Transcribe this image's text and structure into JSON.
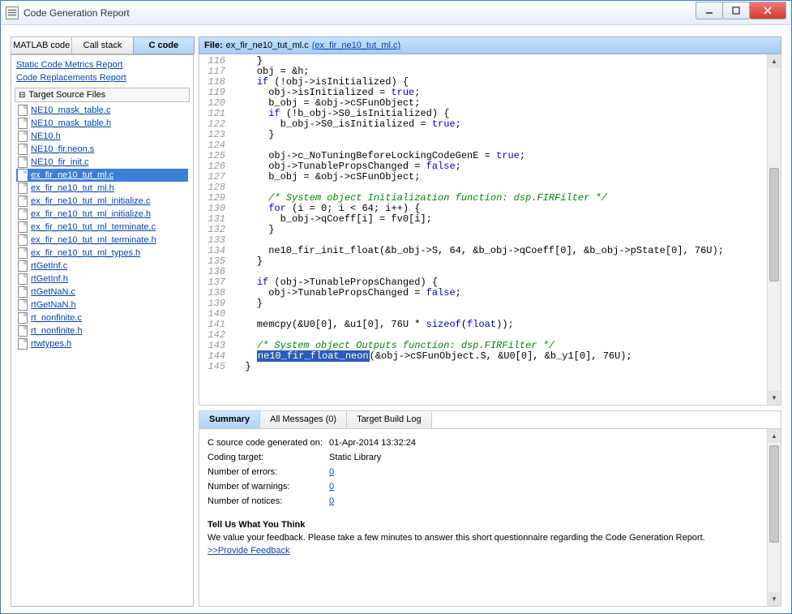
{
  "window": {
    "title": "Code Generation Report"
  },
  "sidebar": {
    "tabs": [
      {
        "label": "MATLAB code",
        "active": false
      },
      {
        "label": "Call stack",
        "active": false
      },
      {
        "label": "C code",
        "active": true
      }
    ],
    "top_links": [
      "Static Code Metrics Report",
      "Code Replacements Report"
    ],
    "section": "Target Source Files",
    "files": [
      {
        "name": "NE10_mask_table.c",
        "selected": false
      },
      {
        "name": "NE10_mask_table.h",
        "selected": false
      },
      {
        "name": "NE10.h",
        "selected": false
      },
      {
        "name": "NE10_fir.neon.s",
        "selected": false
      },
      {
        "name": "NE10_fir_init.c",
        "selected": false
      },
      {
        "name": "ex_fir_ne10_tut_ml.c",
        "selected": true
      },
      {
        "name": "ex_fir_ne10_tut_ml.h",
        "selected": false
      },
      {
        "name": "ex_fir_ne10_tut_ml_initialize.c",
        "selected": false
      },
      {
        "name": "ex_fir_ne10_tut_ml_initialize.h",
        "selected": false
      },
      {
        "name": "ex_fir_ne10_tut_ml_terminate.c",
        "selected": false
      },
      {
        "name": "ex_fir_ne10_tut_ml_terminate.h",
        "selected": false
      },
      {
        "name": "ex_fir_ne10_tut_ml_types.h",
        "selected": false
      },
      {
        "name": "rtGetInf.c",
        "selected": false
      },
      {
        "name": "rtGetInf.h",
        "selected": false
      },
      {
        "name": "rtGetNaN.c",
        "selected": false
      },
      {
        "name": "rtGetNaN.h",
        "selected": false
      },
      {
        "name": "rt_nonfinite.c",
        "selected": false
      },
      {
        "name": "rt_nonfinite.h",
        "selected": false
      },
      {
        "name": "rtwtypes.h",
        "selected": false
      }
    ]
  },
  "filebar": {
    "label": "File:",
    "name": "ex_fir_ne10_tut_ml.c",
    "link": "(ex_fir_ne10_tut_ml.c)"
  },
  "code": [
    {
      "n": 116,
      "t": "    }"
    },
    {
      "n": 117,
      "t": "    obj = &h;"
    },
    {
      "n": 118,
      "segs": [
        [
          "    ",
          ""
        ],
        [
          "if",
          1
        ],
        [
          " (!obj->isInitialized) {",
          ""
        ]
      ]
    },
    {
      "n": 119,
      "segs": [
        [
          "      obj->isInitialized = ",
          ""
        ],
        [
          "true",
          1
        ],
        [
          ";",
          ""
        ]
      ]
    },
    {
      "n": 120,
      "t": "      b_obj = &obj->cSFunObject;"
    },
    {
      "n": 121,
      "segs": [
        [
          "      ",
          ""
        ],
        [
          "if",
          1
        ],
        [
          " (!b_obj->S0_isInitialized) {",
          ""
        ]
      ]
    },
    {
      "n": 122,
      "segs": [
        [
          "        b_obj->S0_isInitialized = ",
          ""
        ],
        [
          "true",
          1
        ],
        [
          ";",
          ""
        ]
      ]
    },
    {
      "n": 123,
      "t": "      }"
    },
    {
      "n": 124,
      "t": ""
    },
    {
      "n": 125,
      "segs": [
        [
          "      obj->c_NoTuningBeforeLockingCodeGenE = ",
          ""
        ],
        [
          "true",
          1
        ],
        [
          ";",
          ""
        ]
      ]
    },
    {
      "n": 126,
      "segs": [
        [
          "      obj->TunablePropsChanged = ",
          ""
        ],
        [
          "false",
          1
        ],
        [
          ";",
          ""
        ]
      ]
    },
    {
      "n": 127,
      "t": "      b_obj = &obj->cSFunObject;"
    },
    {
      "n": 128,
      "t": ""
    },
    {
      "n": 129,
      "segs": [
        [
          "      ",
          ""
        ],
        [
          "/* System object Initialization function: dsp.FIRFilter */",
          2
        ]
      ]
    },
    {
      "n": 130,
      "segs": [
        [
          "      ",
          ""
        ],
        [
          "for",
          1
        ],
        [
          " (i = 0; i < 64; i++) {",
          ""
        ]
      ]
    },
    {
      "n": 131,
      "t": "        b_obj->qCoeff[i] = fv0[i];"
    },
    {
      "n": 132,
      "t": "      }"
    },
    {
      "n": 133,
      "t": ""
    },
    {
      "n": 134,
      "t": "      ne10_fir_init_float(&b_obj->S, 64, &b_obj->qCoeff[0], &b_obj->pState[0], 76U);"
    },
    {
      "n": 135,
      "t": "    }"
    },
    {
      "n": 136,
      "t": ""
    },
    {
      "n": 137,
      "segs": [
        [
          "    ",
          ""
        ],
        [
          "if",
          1
        ],
        [
          " (obj->TunablePropsChanged) {",
          ""
        ]
      ]
    },
    {
      "n": 138,
      "segs": [
        [
          "      obj->TunablePropsChanged = ",
          ""
        ],
        [
          "false",
          1
        ],
        [
          ";",
          ""
        ]
      ]
    },
    {
      "n": 139,
      "t": "    }"
    },
    {
      "n": 140,
      "t": ""
    },
    {
      "n": 141,
      "segs": [
        [
          "    memcpy(&U0[0], &u1[0], 76U * ",
          ""
        ],
        [
          "sizeof",
          1
        ],
        [
          "(",
          ""
        ],
        [
          "float",
          1
        ],
        [
          "));",
          ""
        ]
      ]
    },
    {
      "n": 142,
      "t": ""
    },
    {
      "n": 143,
      "segs": [
        [
          "    ",
          ""
        ],
        [
          "/* System object Outputs function: dsp.FIRFilter */",
          2
        ]
      ]
    },
    {
      "n": 144,
      "segs": [
        [
          "    ",
          ""
        ],
        [
          "ne10_fir_float_neon",
          3
        ],
        [
          "(&obj->cSFunObject.S, &U0[0], &b_y1[0], 76U);",
          ""
        ]
      ]
    },
    {
      "n": 145,
      "t": "  }"
    }
  ],
  "bottom": {
    "tabs": [
      {
        "label": "Summary",
        "active": true
      },
      {
        "label": "All Messages (0)",
        "active": false
      },
      {
        "label": "Target Build Log",
        "active": false
      }
    ],
    "rows": [
      {
        "k": "C source code generated on:",
        "v": "01-Apr-2014 13:32:24",
        "link": false
      },
      {
        "k": "Coding target:",
        "v": "Static Library",
        "link": false
      },
      {
        "k": "Number of errors:",
        "v": "0",
        "link": true
      },
      {
        "k": "Number of warnings:",
        "v": "0",
        "link": true
      },
      {
        "k": "Number of notices:",
        "v": "0",
        "link": true
      }
    ],
    "feedback": {
      "heading": "Tell Us What You Think",
      "text": "We value your feedback. Please take a few minutes to answer this short questionnaire regarding the Code Generation Report.",
      "link": ">>Provide Feedback"
    }
  }
}
